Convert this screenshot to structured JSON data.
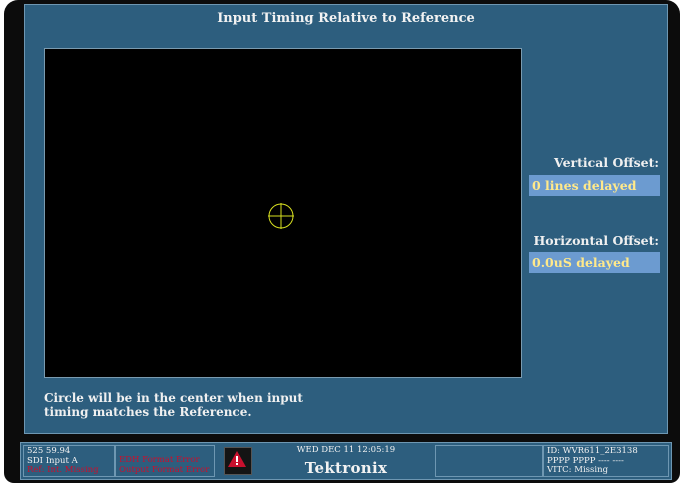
{
  "screen": {
    "title": "Input Timing Relative to Reference",
    "note_line1": "Circle will be in the center when input",
    "note_line2": "timing matches the Reference.",
    "vertical": {
      "label": "Vertical Offset:",
      "value": "0 lines delayed"
    },
    "horizontal": {
      "label": "Horizontal Offset:",
      "value": "0.0uS delayed"
    },
    "crosshair_color": "#d8e020",
    "background_color": "#2d5e7e",
    "highlight_color": "#6c9bd0",
    "value_text_color": "#ffe98a"
  },
  "status": {
    "format": "525 59.94",
    "input": "SDI Input A",
    "ref_status": "Ref: Int. Missing",
    "error1": "EDH Format Error",
    "error2": "Output Format Error",
    "alarm_icon": "alarm-warning-icon",
    "datetime": "WED DEC 11 12:05:19",
    "logo": "Tektronix",
    "id": "ID: WVR611_2E3138",
    "pppp": "PPPP PPPP ---- ----",
    "vitc": "VITC: Missing",
    "alert_color": "#c8102e"
  }
}
